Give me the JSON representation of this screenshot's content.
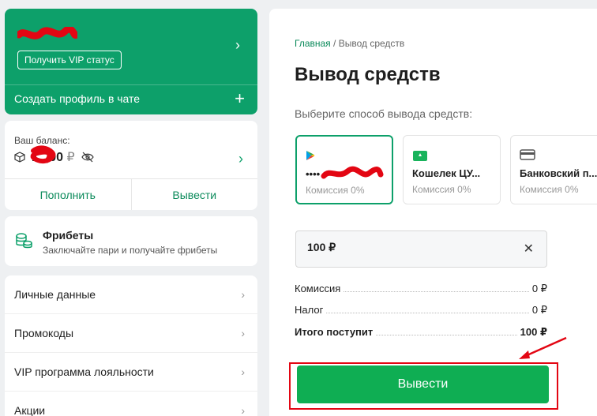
{
  "colors": {
    "accent": "#0da06a",
    "button": "#0fae53",
    "highlight": "#e30613"
  },
  "profile": {
    "vip_label": "Получить VIP статус",
    "create_profile": "Создать профиль в чате",
    "plus_icon": "plus-icon",
    "chevron": "›"
  },
  "balance": {
    "label": "Ваш баланс:",
    "amount": "1..,00",
    "currency": "₽",
    "deposit": "Пополнить",
    "withdraw": "Вывести"
  },
  "freebets": {
    "title": "Фрибеты",
    "subtitle": "Заключайте пари и получайте фрибеты"
  },
  "menu": [
    {
      "label": "Личные данные"
    },
    {
      "label": "Промокоды"
    },
    {
      "label": "VIP программа лояльности"
    },
    {
      "label": "Акции"
    }
  ],
  "breadcrumb": {
    "home": "Главная",
    "sep": "/",
    "current": "Вывод средств"
  },
  "title": "Вывод средств",
  "choose_label": "Выберите способ вывода средств:",
  "methods": [
    {
      "title": "••••",
      "fee": "Комиссия 0%",
      "icon": "google-play-icon",
      "selected": true
    },
    {
      "title": "Кошелек ЦУ...",
      "fee": "Комиссия 0%",
      "icon": "wallet-icon",
      "selected": false
    },
    {
      "title": "Банковский п...",
      "fee": "Комиссия 0%",
      "icon": "bank-card-icon",
      "selected": false
    }
  ],
  "amount_input": {
    "value": "100 ₽"
  },
  "summary": [
    {
      "label": "Комиссия",
      "value": "0 ₽"
    },
    {
      "label": "Налог",
      "value": "0 ₽"
    },
    {
      "label": "Итого поступит",
      "value": "100 ₽"
    }
  ],
  "submit": "Вывести"
}
